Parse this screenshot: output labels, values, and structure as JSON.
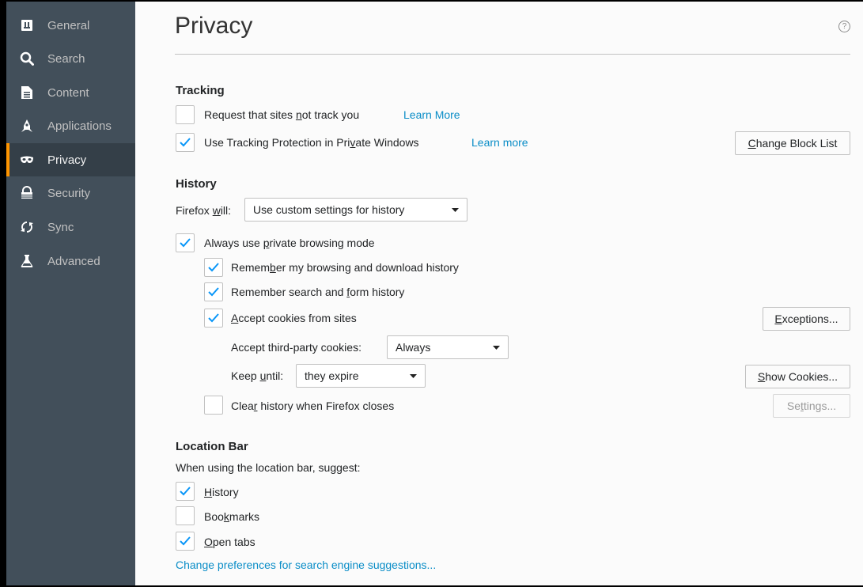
{
  "sidebar": {
    "items": [
      {
        "label": "General",
        "icon": "general-icon"
      },
      {
        "label": "Search",
        "icon": "search-icon"
      },
      {
        "label": "Content",
        "icon": "content-icon"
      },
      {
        "label": "Applications",
        "icon": "applications-icon"
      },
      {
        "label": "Privacy",
        "icon": "privacy-icon",
        "selected": true
      },
      {
        "label": "Security",
        "icon": "security-icon"
      },
      {
        "label": "Sync",
        "icon": "sync-icon"
      },
      {
        "label": "Advanced",
        "icon": "advanced-icon"
      }
    ]
  },
  "page": {
    "title": "Privacy",
    "help": "?"
  },
  "tracking": {
    "heading": "Tracking",
    "dnt": {
      "label_a": "Request that sites ",
      "label_u": "n",
      "label_b": "ot track you",
      "checked": false,
      "link": "Learn More"
    },
    "tp": {
      "label_a": "Use Tracking Protection in Pri",
      "label_u": "v",
      "label_b": "ate Windows",
      "checked": true,
      "link": "Learn more"
    },
    "change_block_list": {
      "u": "C",
      "rest": "hange Block List"
    }
  },
  "history": {
    "heading": "History",
    "will_label_a": "Firefox ",
    "will_label_u": "w",
    "will_label_b": "ill:",
    "will_value": "Use custom settings for history",
    "private_mode": {
      "label_a": "Always use ",
      "label_u": "p",
      "label_b": "rivate browsing mode",
      "checked": true
    },
    "browsing": {
      "label_a": "Remem",
      "label_u": "b",
      "label_b": "er my browsing and download history",
      "checked": true
    },
    "search_form": {
      "label_a": "Remember search and ",
      "label_u": "f",
      "label_b": "orm history",
      "checked": true
    },
    "cookies": {
      "label_a": "",
      "label_u": "A",
      "label_b": "ccept cookies from sites",
      "checked": true
    },
    "exceptions": {
      "u": "E",
      "rest": "xceptions..."
    },
    "third_party_label": "Accept third-party cookies:",
    "third_party_value": "Always",
    "keep_label_a": "Keep ",
    "keep_label_u": "u",
    "keep_label_b": "ntil:",
    "keep_value": "they expire",
    "show_cookies": {
      "u": "S",
      "rest": "how Cookies..."
    },
    "clear": {
      "label_a": "Clea",
      "label_u": "r",
      "label_b": " history when Firefox closes",
      "checked": false
    },
    "settings": {
      "a": "Se",
      "u": "t",
      "rest": "tings..."
    }
  },
  "location_bar": {
    "heading": "Location Bar",
    "intro": "When using the location bar, suggest:",
    "history": {
      "label_u": "H",
      "label_b": "istory",
      "checked": true
    },
    "bookmarks": {
      "label_a": "Boo",
      "label_u": "k",
      "label_b": "marks",
      "checked": false
    },
    "open_tabs": {
      "label_u": "O",
      "label_b": "pen tabs",
      "checked": true
    },
    "search_prefs_link": "Change preferences for search engine suggestions..."
  },
  "colors": {
    "sidebar": "#424f5a",
    "selected": "#343f48",
    "accent": "#ff9500",
    "link": "#0a8dc7",
    "check": "#0996f8"
  }
}
